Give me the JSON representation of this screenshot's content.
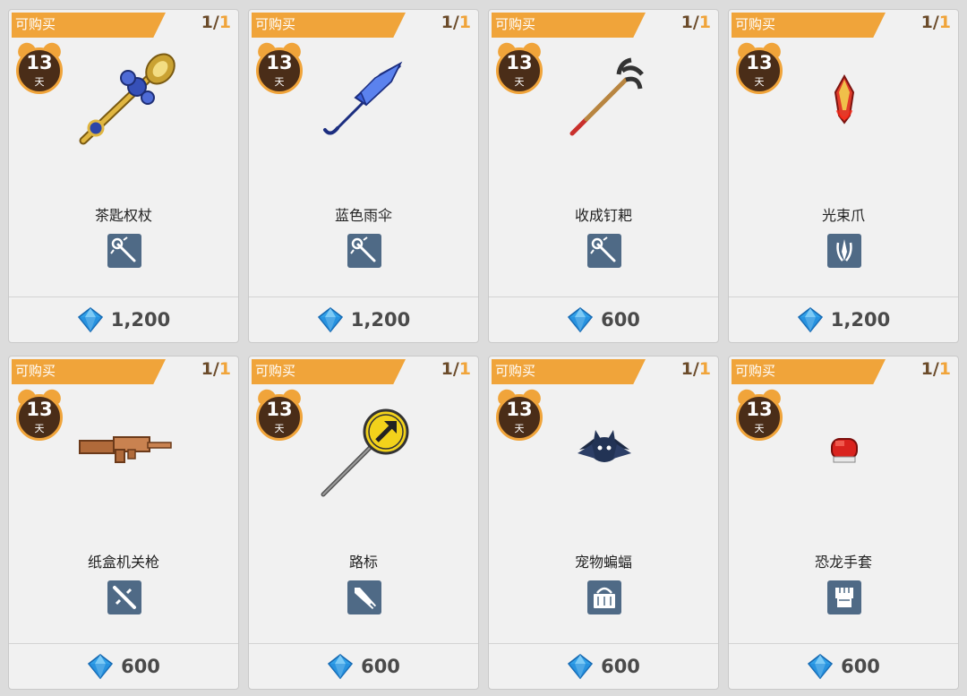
{
  "colors": {
    "banner": "#f0a43a",
    "timer_face": "#4a2d18",
    "badge": "#4f6a86",
    "gem": "#2f9fe8",
    "price_text": "#4a4a4a"
  },
  "shop_items": [
    {
      "banner_label": "可购买",
      "stock_remaining": "1",
      "stock_sep": "/",
      "stock_max": "1",
      "timer_days": "13",
      "timer_unit": "天",
      "name": "茶匙权杖",
      "item_icon": "golden-staff-icon",
      "type_icon": "staff-type-icon",
      "price": "1,200",
      "currency_icon": "blue-gem-icon"
    },
    {
      "banner_label": "可购买",
      "stock_remaining": "1",
      "stock_sep": "/",
      "stock_max": "1",
      "timer_days": "13",
      "timer_unit": "天",
      "name": "蓝色雨伞",
      "item_icon": "blue-umbrella-icon",
      "type_icon": "staff-type-icon",
      "price": "1,200",
      "currency_icon": "blue-gem-icon"
    },
    {
      "banner_label": "可购买",
      "stock_remaining": "1",
      "stock_sep": "/",
      "stock_max": "1",
      "timer_days": "13",
      "timer_unit": "天",
      "name": "收成钉耙",
      "item_icon": "rake-icon",
      "type_icon": "staff-type-icon",
      "price": "600",
      "currency_icon": "blue-gem-icon"
    },
    {
      "banner_label": "可购买",
      "stock_remaining": "1",
      "stock_sep": "/",
      "stock_max": "1",
      "timer_days": "13",
      "timer_unit": "天",
      "name": "光束爪",
      "item_icon": "beam-claw-icon",
      "type_icon": "claw-type-icon",
      "price": "1,200",
      "currency_icon": "blue-gem-icon"
    },
    {
      "banner_label": "可购买",
      "stock_remaining": "1",
      "stock_sep": "/",
      "stock_max": "1",
      "timer_days": "13",
      "timer_unit": "天",
      "name": "纸盒机关枪",
      "item_icon": "cardboard-gun-icon",
      "type_icon": "gun-type-icon",
      "price": "600",
      "currency_icon": "blue-gem-icon"
    },
    {
      "banner_label": "可购买",
      "stock_remaining": "1",
      "stock_sep": "/",
      "stock_max": "1",
      "timer_days": "13",
      "timer_unit": "天",
      "name": "路标",
      "item_icon": "road-sign-icon",
      "type_icon": "blade-type-icon",
      "price": "600",
      "currency_icon": "blue-gem-icon"
    },
    {
      "banner_label": "可购买",
      "stock_remaining": "1",
      "stock_sep": "/",
      "stock_max": "1",
      "timer_days": "13",
      "timer_unit": "天",
      "name": "宠物蝙蝠",
      "item_icon": "bat-icon",
      "type_icon": "basket-type-icon",
      "price": "600",
      "currency_icon": "blue-gem-icon"
    },
    {
      "banner_label": "可购买",
      "stock_remaining": "1",
      "stock_sep": "/",
      "stock_max": "1",
      "timer_days": "13",
      "timer_unit": "天",
      "name": "恐龙手套",
      "item_icon": "red-glove-icon",
      "type_icon": "fist-type-icon",
      "price": "600",
      "currency_icon": "blue-gem-icon"
    }
  ]
}
